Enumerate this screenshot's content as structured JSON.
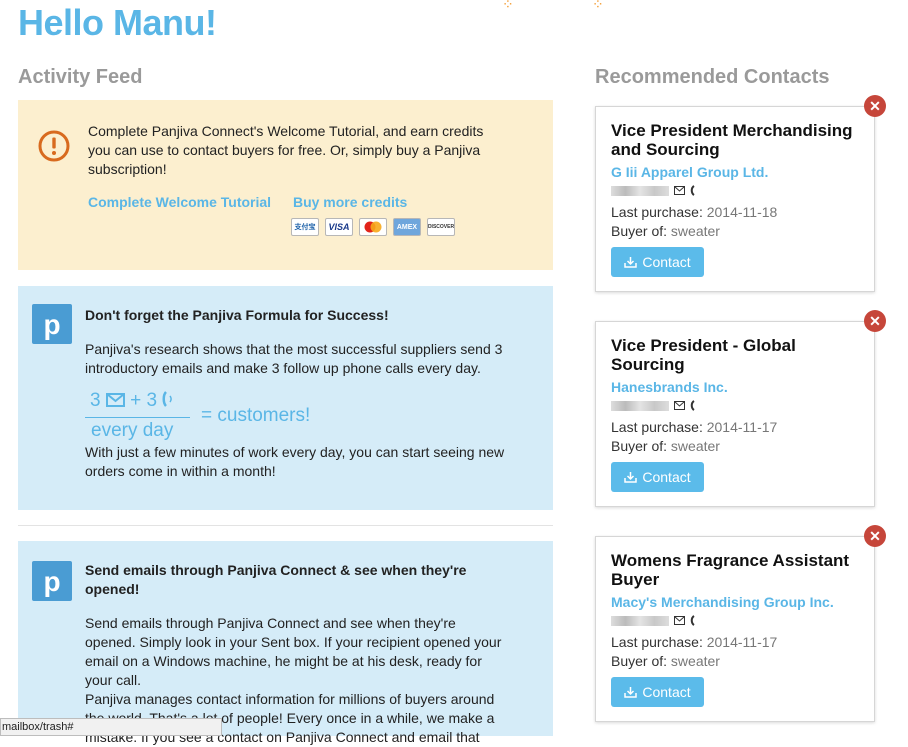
{
  "greeting": "Hello Manu!",
  "activity_feed": {
    "title": "Activity Feed",
    "welcome_card": {
      "text": "Complete Panjiva Connect's Welcome Tutorial, and earn credits you can use to contact buyers for free. Or, simply buy a Panjiva subscription!",
      "link_tutorial": "Complete Welcome Tutorial",
      "link_credits": "Buy more credits",
      "payment_logos": [
        "支付宝 Alipay",
        "VISA",
        "MasterCard",
        "AMEX",
        "DISCOVER"
      ]
    },
    "formula_card": {
      "logo": "p",
      "title": "Don't forget the Panjiva Formula for Success!",
      "body1": "Panjiva's research shows that the most successful suppliers send 3 introductory emails and make 3 follow up phone calls every day.",
      "formula_emails": "3",
      "formula_plus": "+ 3",
      "formula_denominator": "every day",
      "formula_result": "= customers!",
      "body2": "With just a few minutes of work every day, you can start seeing new orders come in within a month!"
    },
    "email_card": {
      "logo": "p",
      "title": "Send emails through Panjiva Connect & see when they're opened!",
      "body1": "Send emails through Panjiva Connect and see when they're opened. Simply look in your Sent box. If your recipient opened your email on a Windows machine, he might be at his desk, ready for your call.",
      "body2": "Panjiva manages contact information for millions of buyers around the world. That's a lot of people! Every once in a while, we make a mistake. If you see a contact on Panjiva Connect and email that"
    }
  },
  "recommended": {
    "title": "Recommended Contacts",
    "last_purchase_label": "Last purchase:",
    "buyer_of_label": "Buyer of:",
    "contact_button": "Contact",
    "close_glyph": "✕",
    "contacts": [
      {
        "title": "Vice President Merchandising and Sourcing",
        "company": "G Iii Apparel Group Ltd.",
        "last_purchase": "2014-11-18",
        "buyer_of": "sweater"
      },
      {
        "title": "Vice President - Global Sourcing",
        "company": "Hanesbrands Inc.",
        "last_purchase": "2014-11-17",
        "buyer_of": "sweater"
      },
      {
        "title": "Womens Fragrance Assistant Buyer",
        "company": "Macy's Merchandising Group Inc.",
        "last_purchase": "2014-11-17",
        "buyer_of": "sweater"
      }
    ]
  },
  "status_bar": "mailbox/trash#",
  "colors": {
    "accent": "#5ab6e6",
    "warning_bg": "#fcefcf",
    "tip_bg": "#d5ecf8",
    "close": "#c6463a",
    "warning_icon": "#d86a1e"
  }
}
